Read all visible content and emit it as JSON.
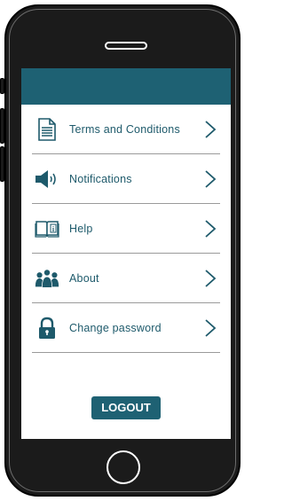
{
  "menu": {
    "items": [
      {
        "label": "Terms and Conditions",
        "icon": "document-icon"
      },
      {
        "label": "Notifications",
        "icon": "speaker-icon"
      },
      {
        "label": "Help",
        "icon": "help-book-icon"
      },
      {
        "label": "About",
        "icon": "people-icon"
      },
      {
        "label": "Change password",
        "icon": "lock-icon"
      }
    ]
  },
  "logout_label": "LOGOUT",
  "colors": {
    "primary": "#1e6173",
    "text": "#1e5a6b",
    "divider": "#9a9a9a"
  }
}
